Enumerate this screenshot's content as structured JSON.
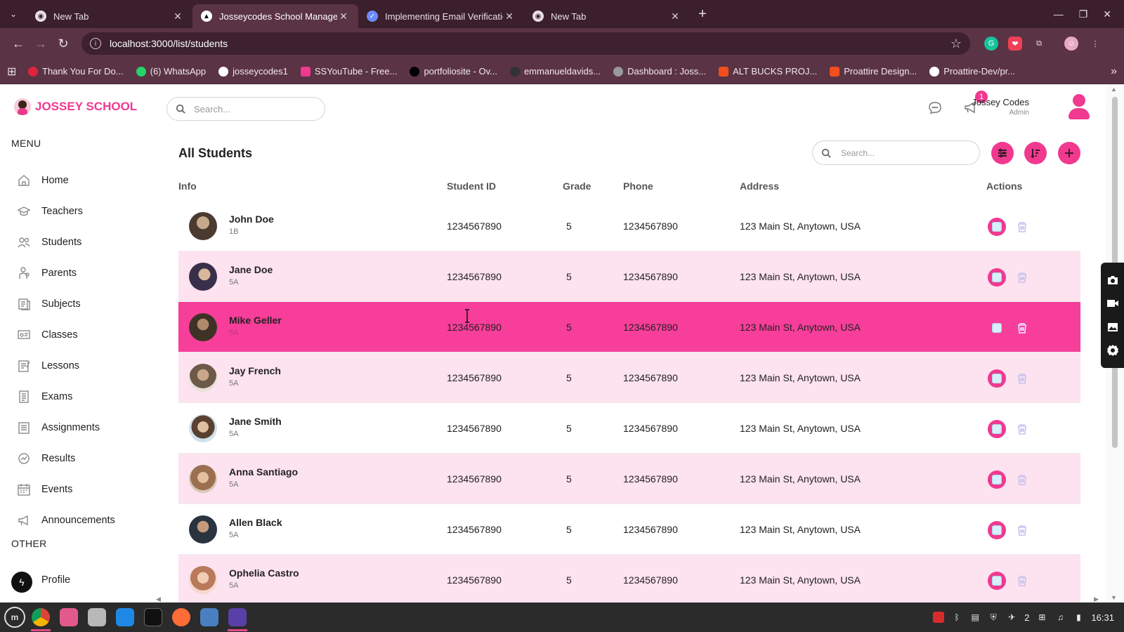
{
  "browser": {
    "tabs": [
      {
        "title": "New Tab",
        "icon": "chrome-icon",
        "active": false
      },
      {
        "title": "Josseycodes School Management",
        "icon": "nextjs-icon",
        "active": true
      },
      {
        "title": "Implementing Email Verification",
        "icon": "vercel-icon",
        "active": false
      },
      {
        "title": "New Tab",
        "icon": "chrome-icon",
        "active": false
      }
    ],
    "new_tab": "+",
    "url": "localhost:3000/list/students",
    "bookmarks": [
      {
        "label": "Thank You For Do...",
        "color": "#e0243a"
      },
      {
        "label": "(6) WhatsApp",
        "color": "#25d366"
      },
      {
        "label": "josseycodes1",
        "color": "#ffffff"
      },
      {
        "label": "SSYouTube - Free...",
        "color": "#f0398f"
      },
      {
        "label": "portfoliosite - Ov...",
        "color": "#000000"
      },
      {
        "label": "emmanueldavids...",
        "color": "#333333"
      },
      {
        "label": "Dashboard : Joss...",
        "color": "#999999"
      },
      {
        "label": "ALT BUCKS PROJ...",
        "color": "#f24e1e"
      },
      {
        "label": "Proattire Design...",
        "color": "#f24e1e"
      },
      {
        "label": "Proattire-Dev/pr...",
        "color": "#ffffff"
      }
    ]
  },
  "app": {
    "logo_text": "JOSSEY SCHOOL",
    "topbar_search_placeholder": "Search...",
    "notification_count": "1",
    "user": {
      "name": "Jossey Codes",
      "role": "Admin"
    },
    "menu_label": "MENU",
    "other_label": "OTHER",
    "menu": [
      {
        "label": "Home",
        "icon": "home-icon"
      },
      {
        "label": "Teachers",
        "icon": "teacher-icon"
      },
      {
        "label": "Students",
        "icon": "student-icon"
      },
      {
        "label": "Parents",
        "icon": "parent-icon"
      },
      {
        "label": "Subjects",
        "icon": "subject-icon"
      },
      {
        "label": "Classes",
        "icon": "class-icon"
      },
      {
        "label": "Lessons",
        "icon": "lesson-icon"
      },
      {
        "label": "Exams",
        "icon": "exam-icon"
      },
      {
        "label": "Assignments",
        "icon": "assignment-icon"
      },
      {
        "label": "Results",
        "icon": "result-icon"
      },
      {
        "label": "Events",
        "icon": "calendar-icon"
      },
      {
        "label": "Announcements",
        "icon": "announcement-icon"
      }
    ],
    "other": [
      {
        "label": "Profile",
        "icon": "profile-icon"
      }
    ],
    "page_title": "All Students",
    "list_search_placeholder": "Search...",
    "columns": {
      "info": "Info",
      "student_id": "Student ID",
      "grade": "Grade",
      "phone": "Phone",
      "address": "Address",
      "actions": "Actions"
    },
    "students": [
      {
        "name": "John Doe",
        "class": "1B",
        "id": "1234567890",
        "grade": "5",
        "phone": "1234567890",
        "address": "123 Main St, Anytown, USA"
      },
      {
        "name": "Jane Doe",
        "class": "5A",
        "id": "1234567890",
        "grade": "5",
        "phone": "1234567890",
        "address": "123 Main St, Anytown, USA"
      },
      {
        "name": "Mike Geller",
        "class": "5A",
        "id": "1234567890",
        "grade": "5",
        "phone": "1234567890",
        "address": "123 Main St, Anytown, USA"
      },
      {
        "name": "Jay French",
        "class": "5A",
        "id": "1234567890",
        "grade": "5",
        "phone": "1234567890",
        "address": "123 Main St, Anytown, USA"
      },
      {
        "name": "Jane Smith",
        "class": "5A",
        "id": "1234567890",
        "grade": "5",
        "phone": "1234567890",
        "address": "123 Main St, Anytown, USA"
      },
      {
        "name": "Anna Santiago",
        "class": "5A",
        "id": "1234567890",
        "grade": "5",
        "phone": "1234567890",
        "address": "123 Main St, Anytown, USA"
      },
      {
        "name": "Allen Black",
        "class": "5A",
        "id": "1234567890",
        "grade": "5",
        "phone": "1234567890",
        "address": "123 Main St, Anytown, USA"
      },
      {
        "name": "Ophelia Castro",
        "class": "5A",
        "id": "1234567890",
        "grade": "5",
        "phone": "1234567890",
        "address": "123 Main St, Anytown, USA"
      }
    ]
  },
  "taskbar": {
    "clock": "16:31",
    "tray_count": "2"
  },
  "colors": {
    "accent": "#f0398f",
    "row_alt": "#fde2ef",
    "row_hover": "#f73e9a",
    "browser_frame": "#5a3345"
  }
}
